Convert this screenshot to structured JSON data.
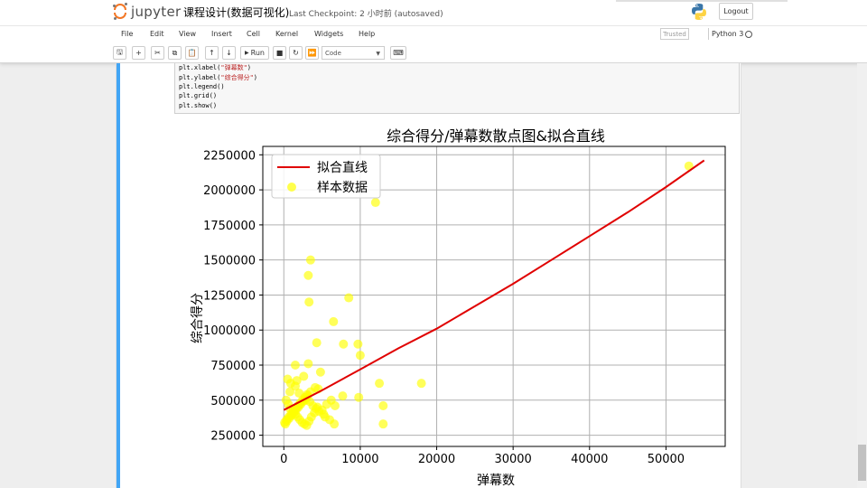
{
  "header": {
    "logo_text": "jupyter",
    "notebook_title": "课程设计(数据可视化)",
    "checkpoint_text": "Last Checkpoint: 2 小时前  (autosaved)",
    "logout_label": "Logout",
    "python_logo_icon": "python-logo-icon"
  },
  "menubar": {
    "items": [
      "File",
      "Edit",
      "View",
      "Insert",
      "Cell",
      "Kernel",
      "Widgets",
      "Help"
    ],
    "trusted_label": "Trusted",
    "kernel_name": "Python 3"
  },
  "toolbar": {
    "buttons": [
      {
        "icon": "save-icon",
        "glyph": "🖫"
      },
      {
        "icon": "plus-icon",
        "glyph": "+"
      },
      {
        "icon": "cut-icon",
        "glyph": "✂"
      },
      {
        "icon": "copy-icon",
        "glyph": "⧉"
      },
      {
        "icon": "paste-icon",
        "glyph": "📋"
      },
      {
        "icon": "arrow-up-icon",
        "glyph": "↑"
      },
      {
        "icon": "arrow-down-icon",
        "glyph": "↓"
      },
      {
        "icon": "run-icon",
        "glyph": "▶"
      },
      {
        "icon": "stop-icon",
        "glyph": "■"
      },
      {
        "icon": "restart-icon",
        "glyph": "↻"
      },
      {
        "icon": "fast-forward-icon",
        "glyph": "⏩"
      },
      {
        "icon": "keyboard-icon",
        "glyph": "⌨"
      }
    ],
    "run_label": "Run",
    "cell_type": "Code"
  },
  "code": {
    "lines": [
      {
        "prefix": "plt.xlabel(",
        "str": "\"弹幕数\"",
        "suffix": ")"
      },
      {
        "prefix": "plt.ylabel(",
        "str": "\"综合得分\"",
        "suffix": ")"
      },
      {
        "prefix": "plt.legend()",
        "str": "",
        "suffix": ""
      },
      {
        "prefix": "plt.grid()",
        "str": "",
        "suffix": ""
      },
      {
        "prefix": "plt.show()",
        "str": "",
        "suffix": ""
      }
    ]
  },
  "chart_data": {
    "type": "scatter",
    "title": "综合得分/弹幕数散点图&拟合直线",
    "xlabel": "弹幕数",
    "ylabel": "综合得分",
    "xlim": [
      -2750,
      57750
    ],
    "ylim": [
      170000,
      2310000
    ],
    "xticks": [
      0,
      10000,
      20000,
      30000,
      40000,
      50000
    ],
    "yticks": [
      250000,
      500000,
      750000,
      1000000,
      1250000,
      1500000,
      1750000,
      2000000,
      2250000
    ],
    "grid": true,
    "legend_position": "top-left",
    "colors": {
      "fit_line": "#e00000",
      "points": "#ffff00",
      "grid": "#b0b0b0"
    },
    "series": [
      {
        "name": "拟合直线",
        "kind": "line",
        "x": [
          0,
          5000,
          10000,
          15000,
          20000,
          25000,
          30000,
          35000,
          40000,
          45000,
          50000,
          55000
        ],
        "y": [
          430000,
          570000,
          720000,
          870000,
          1010000,
          1170000,
          1330000,
          1500000,
          1670000,
          1840000,
          2020000,
          2210000
        ]
      },
      {
        "name": "样本数据",
        "kind": "scatter",
        "x": [
          53000,
          12000,
          3500,
          3200,
          3300,
          8500,
          6500,
          4300,
          7800,
          9700,
          10000,
          1500,
          3200,
          2600,
          500,
          4800,
          12500,
          18000,
          13000,
          13000,
          6700,
          7700,
          9800,
          4500,
          900,
          1500,
          2000,
          300,
          600,
          800,
          1200,
          1500,
          1800,
          2100,
          2400,
          2700,
          3000,
          3300,
          3600,
          4000,
          4400,
          5000,
          5600,
          6200,
          200,
          400,
          700,
          1000,
          1300,
          1600,
          1900,
          2200,
          2500,
          2800,
          3100,
          3400,
          3800,
          4200,
          4600,
          5200,
          100,
          350,
          650,
          950,
          1250,
          1550,
          1850,
          2150,
          2450,
          2750,
          3050,
          3500,
          4100,
          5400,
          6000,
          6600,
          800,
          1700,
          2900
        ],
        "y": [
          2170000,
          1910000,
          1500000,
          1390000,
          1200000,
          1230000,
          1060000,
          910000,
          900000,
          900000,
          820000,
          750000,
          760000,
          670000,
          650000,
          700000,
          620000,
          620000,
          460000,
          330000,
          460000,
          530000,
          520000,
          580000,
          620000,
          600000,
          550000,
          500000,
          470000,
          440000,
          420000,
          400000,
          380000,
          360000,
          340000,
          330000,
          320000,
          350000,
          380000,
          410000,
          450000,
          430000,
          470000,
          500000,
          330000,
          350000,
          370000,
          390000,
          410000,
          430000,
          450000,
          470000,
          490000,
          510000,
          530000,
          490000,
          460000,
          440000,
          420000,
          400000,
          340000,
          360000,
          380000,
          400000,
          420000,
          440000,
          460000,
          480000,
          500000,
          520000,
          540000,
          560000,
          590000,
          380000,
          360000,
          330000,
          560000,
          640000,
          500000
        ]
      }
    ]
  }
}
